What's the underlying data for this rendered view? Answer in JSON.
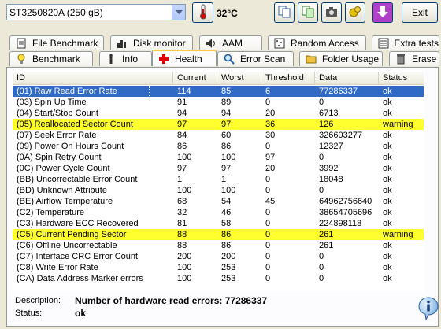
{
  "toolbar": {
    "drive": "ST3250820A (250 gB)",
    "temperature": "32°C",
    "exit_label": "Exit",
    "buttons": [
      "copy-icon",
      "copy-image-icon",
      "screenshot-icon",
      "options-icon",
      "down-arrow-icon"
    ]
  },
  "tabs_top": [
    "File Benchmark",
    "Disk monitor",
    "AAM",
    "Random Access",
    "Extra tests"
  ],
  "tabs_bottom": [
    "Benchmark",
    "Info",
    "Health",
    "Error Scan",
    "Folder Usage",
    "Erase"
  ],
  "active_tab": "Health",
  "table": {
    "headers": [
      "ID",
      "Current",
      "Worst",
      "Threshold",
      "Data",
      "Status"
    ],
    "rows": [
      {
        "id": "(01) Raw Read Error Rate",
        "current": "114",
        "worst": "85",
        "threshold": "6",
        "data": "77286337",
        "status": "ok",
        "style": "sel"
      },
      {
        "id": "(03) Spin Up Time",
        "current": "91",
        "worst": "89",
        "threshold": "0",
        "data": "0",
        "status": "ok",
        "style": ""
      },
      {
        "id": "(04) Start/Stop Count",
        "current": "94",
        "worst": "94",
        "threshold": "20",
        "data": "6713",
        "status": "ok",
        "style": ""
      },
      {
        "id": "(05) Reallocated Sector Count",
        "current": "97",
        "worst": "97",
        "threshold": "36",
        "data": "126",
        "status": "warning",
        "style": "warn"
      },
      {
        "id": "(07) Seek Error Rate",
        "current": "84",
        "worst": "60",
        "threshold": "30",
        "data": "326603277",
        "status": "ok",
        "style": ""
      },
      {
        "id": "(09) Power On Hours Count",
        "current": "86",
        "worst": "86",
        "threshold": "0",
        "data": "12327",
        "status": "ok",
        "style": ""
      },
      {
        "id": "(0A) Spin Retry Count",
        "current": "100",
        "worst": "100",
        "threshold": "97",
        "data": "0",
        "status": "ok",
        "style": ""
      },
      {
        "id": "(0C) Power Cycle Count",
        "current": "97",
        "worst": "97",
        "threshold": "20",
        "data": "3992",
        "status": "ok",
        "style": ""
      },
      {
        "id": "(BB) Uncorrectable Error Count",
        "current": "1",
        "worst": "1",
        "threshold": "0",
        "data": "18048",
        "status": "ok",
        "style": ""
      },
      {
        "id": "(BD) Unknown Attribute",
        "current": "100",
        "worst": "100",
        "threshold": "0",
        "data": "0",
        "status": "ok",
        "style": ""
      },
      {
        "id": "(BE) Airflow Temperature",
        "current": "68",
        "worst": "54",
        "threshold": "45",
        "data": "64962756640",
        "status": "ok",
        "style": ""
      },
      {
        "id": "(C2) Temperature",
        "current": "32",
        "worst": "46",
        "threshold": "0",
        "data": "38654705696",
        "status": "ok",
        "style": ""
      },
      {
        "id": "(C3) Hardware ECC Recovered",
        "current": "81",
        "worst": "58",
        "threshold": "0",
        "data": "224898118",
        "status": "ok",
        "style": ""
      },
      {
        "id": "(C5) Current Pending Sector",
        "current": "88",
        "worst": "86",
        "threshold": "0",
        "data": "261",
        "status": "warning",
        "style": "warn"
      },
      {
        "id": "(C6) Offline Uncorrectable",
        "current": "88",
        "worst": "86",
        "threshold": "0",
        "data": "261",
        "status": "ok",
        "style": ""
      },
      {
        "id": "(C7) Interface CRC Error Count",
        "current": "200",
        "worst": "200",
        "threshold": "0",
        "data": "0",
        "status": "ok",
        "style": ""
      },
      {
        "id": "(C8) Write Error Rate",
        "current": "100",
        "worst": "253",
        "threshold": "0",
        "data": "0",
        "status": "ok",
        "style": ""
      },
      {
        "id": "(CA) Data Address Marker errors",
        "current": "100",
        "worst": "253",
        "threshold": "0",
        "data": "0",
        "status": "ok",
        "style": ""
      }
    ]
  },
  "details": {
    "description_label": "Description:",
    "description_value": "Number of hardware read errors: 77286337",
    "status_label": "Status:",
    "status_value": "ok"
  },
  "colors": {
    "selected": "#316ac5",
    "warning": "#ffff30",
    "accent_tab": "#ffc83c"
  }
}
